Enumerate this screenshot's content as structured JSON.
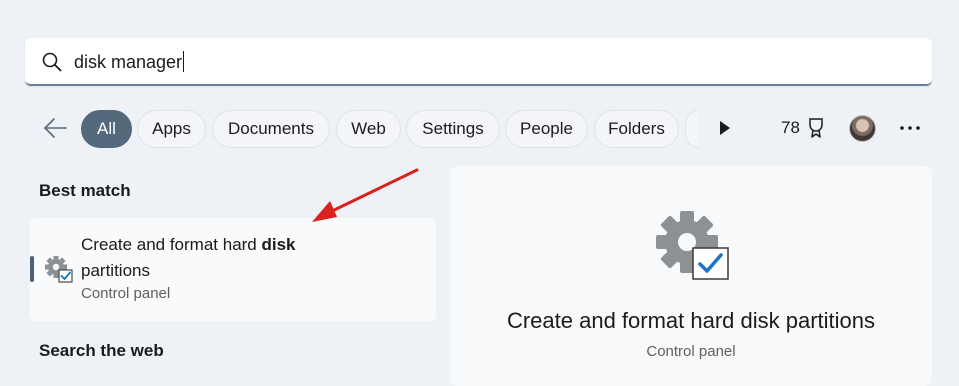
{
  "search": {
    "query": "disk manager",
    "icon": "search-icon"
  },
  "filters": {
    "back_icon": "back-arrow-icon",
    "tabs": [
      {
        "label": "All",
        "active": true
      },
      {
        "label": "Apps",
        "active": false
      },
      {
        "label": "Documents",
        "active": false
      },
      {
        "label": "Web",
        "active": false
      },
      {
        "label": "Settings",
        "active": false
      },
      {
        "label": "People",
        "active": false
      },
      {
        "label": "Folders",
        "active": false
      }
    ],
    "more_tabs_icon": "play-icon"
  },
  "account": {
    "rewards_points": "78",
    "rewards_icon": "trophy-icon",
    "more_icon": "more-icon"
  },
  "results": {
    "best_match_label": "Best match",
    "best_match": {
      "title_pre": "Create and format hard ",
      "title_bold": "disk",
      "title_post": "partitions",
      "subtitle": "Control panel",
      "icon": "gear-check-icon"
    },
    "search_web_label": "Search the web"
  },
  "preview": {
    "title": "Create and format hard disk partitions",
    "subtitle": "Control panel",
    "icon": "gear-check-icon"
  },
  "colors": {
    "accent": "#55697d",
    "annotation_arrow": "#d9211d",
    "checkbox_blue": "#1a73c8"
  }
}
